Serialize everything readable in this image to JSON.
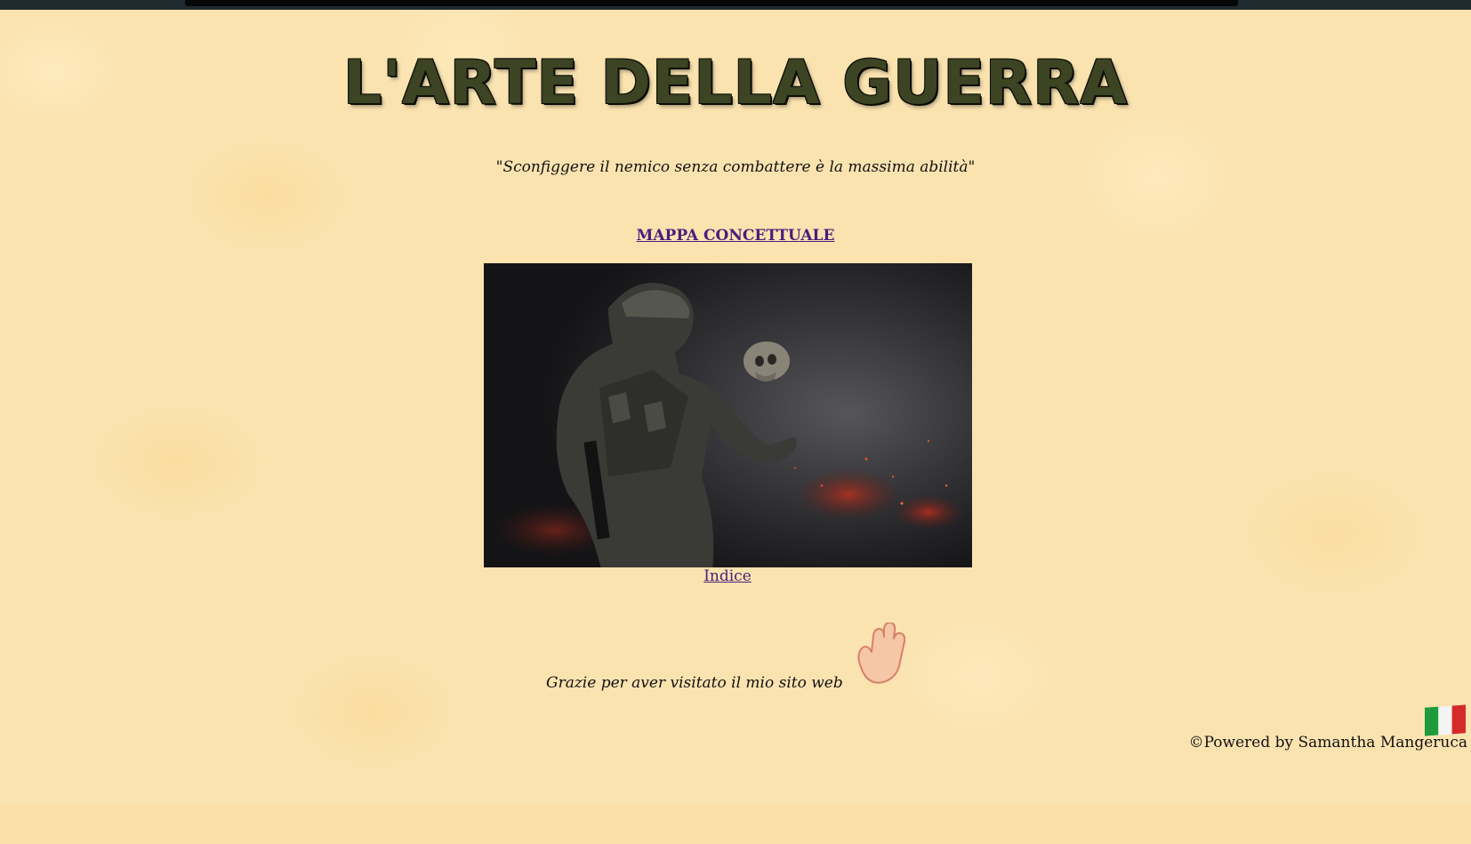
{
  "page": {
    "title": "L'ARTE DELLA GUERRA",
    "quote": "\"Sconfiggere il nemico senza combattere è la massima abilità\""
  },
  "links": {
    "concept_map": "MAPPA CONCETTUALE",
    "index": "Indice"
  },
  "hero_image": {
    "icon": "soldier-with-skull-image"
  },
  "footer": {
    "thanks": "Grazie per aver visitato il mio sito web",
    "credit": "©Powered by Samantha Mangeruca",
    "hand_icon": "waving-hand-icon",
    "flag_icon": "italian-flag-icon"
  },
  "colors": {
    "background": "#fbe3b0",
    "link": "#4a1e7a",
    "title": "#3c4423"
  }
}
